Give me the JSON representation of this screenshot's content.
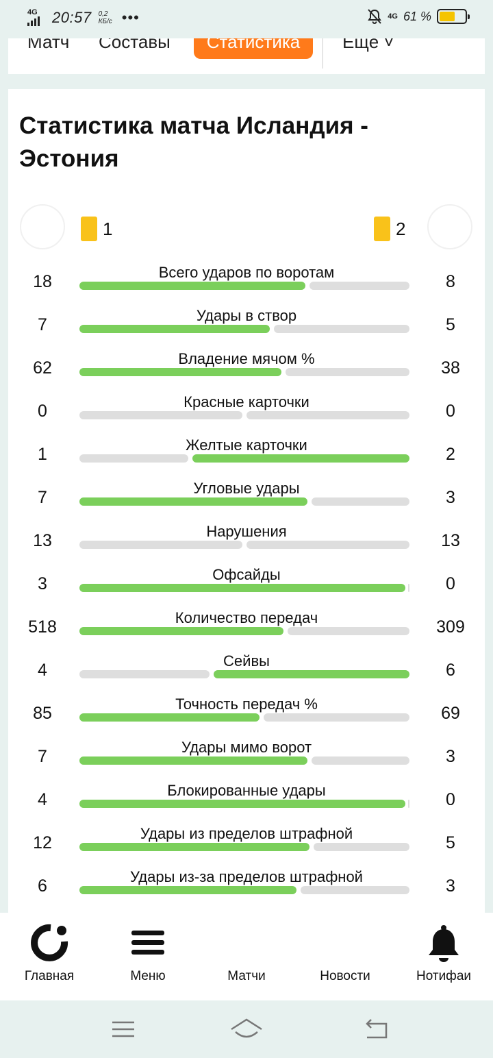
{
  "status_bar": {
    "network_tag": "4G",
    "time": "20:57",
    "speed_value": "0,2",
    "speed_unit": "КБ/с",
    "more": "•••",
    "network_tag_right": "4G",
    "battery_text": "61 %",
    "battery_level": 0.61,
    "battery_color": "#f5c400"
  },
  "tabs": {
    "match": "Матч",
    "lineups": "Составы",
    "statistics": "Статистика",
    "more": "Ещё ˅",
    "active_color": "#ff7a1a"
  },
  "page_title": "Статистика матча Исландия - Эстония",
  "teams": {
    "home_cards": "1",
    "away_cards": "2",
    "card_color": "#f9c21a"
  },
  "bar_colors": {
    "leader": "#7bcf5b",
    "other": "#dedede"
  },
  "stats": [
    {
      "label": "Всего ударов по воротам",
      "home": "18",
      "away": "8"
    },
    {
      "label": "Удары в створ",
      "home": "7",
      "away": "5"
    },
    {
      "label": "Владение мячом %",
      "home": "62",
      "away": "38"
    },
    {
      "label": "Красные карточки",
      "home": "0",
      "away": "0"
    },
    {
      "label": "Желтые карточки",
      "home": "1",
      "away": "2"
    },
    {
      "label": "Угловые удары",
      "home": "7",
      "away": "3"
    },
    {
      "label": "Нарушения",
      "home": "13",
      "away": "13"
    },
    {
      "label": "Офсайды",
      "home": "3",
      "away": "0"
    },
    {
      "label": "Количество передач",
      "home": "518",
      "away": "309"
    },
    {
      "label": "Сейвы",
      "home": "4",
      "away": "6"
    },
    {
      "label": "Точность передач %",
      "home": "85",
      "away": "69"
    },
    {
      "label": "Удары мимо ворот",
      "home": "7",
      "away": "3"
    },
    {
      "label": "Блокированные удары",
      "home": "4",
      "away": "0"
    },
    {
      "label": "Удары из пределов штрафной",
      "home": "12",
      "away": "5"
    },
    {
      "label": "Удары из-за пределов штрафной",
      "home": "6",
      "away": "3"
    }
  ],
  "bottom_nav": {
    "home": "Главная",
    "menu": "Меню",
    "matches": "Матчи",
    "news": "Новости",
    "notifications": "Нотифаи"
  }
}
